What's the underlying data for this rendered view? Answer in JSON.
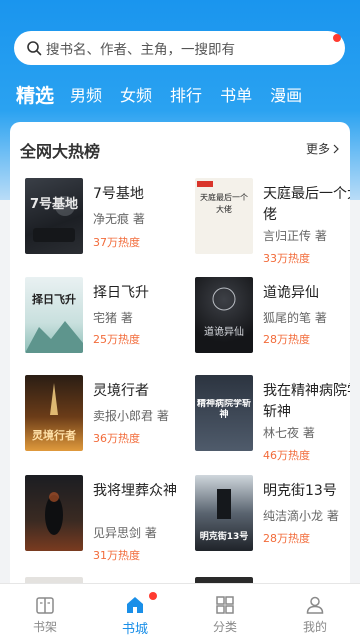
{
  "search": {
    "placeholder": "搜书名、作者、主角，一搜即有"
  },
  "tabs": [
    "精选",
    "男频",
    "女频",
    "排行",
    "书单",
    "漫画"
  ],
  "section": {
    "title": "全网大热榜",
    "more": "更多"
  },
  "books": [
    {
      "title": "7号基地",
      "author": "净无痕 著",
      "heat": "37万热度",
      "cover_text": "7号基地"
    },
    {
      "title": "天庭最后一个大佬",
      "author": "言归正传 著",
      "heat": "33万热度",
      "cover_text": "天庭最后一个大佬"
    },
    {
      "title": "择日飞升",
      "author": "宅猪 著",
      "heat": "25万热度",
      "cover_text": "择日飞升"
    },
    {
      "title": "道诡异仙",
      "author": "狐尾的笔 著",
      "heat": "28万热度",
      "cover_text": "道诡异仙"
    },
    {
      "title": "灵境行者",
      "author": "卖报小郎君 著",
      "heat": "36万热度",
      "cover_text": "灵境行者"
    },
    {
      "title": "我在精神病院学斩神",
      "author": "林七夜 著",
      "heat": "46万热度",
      "cover_text": "精神病院学斩神"
    },
    {
      "title": "我将埋葬众神",
      "author": "见异思剑 著",
      "heat": "31万热度",
      "cover_text": ""
    },
    {
      "title": "明克街13号",
      "author": "纯洁滴小龙 著",
      "heat": "28万热度",
      "cover_text": "明克街13号"
    }
  ],
  "bottom_nav": [
    {
      "label": "书架",
      "icon": "bookshelf-icon"
    },
    {
      "label": "书城",
      "icon": "store-icon",
      "active": true
    },
    {
      "label": "分类",
      "icon": "category-icon"
    },
    {
      "label": "我的",
      "icon": "profile-icon"
    }
  ],
  "colors": {
    "primary": "#1a95ee",
    "heat": "#f26b3a",
    "badge": "#ff3b30"
  }
}
